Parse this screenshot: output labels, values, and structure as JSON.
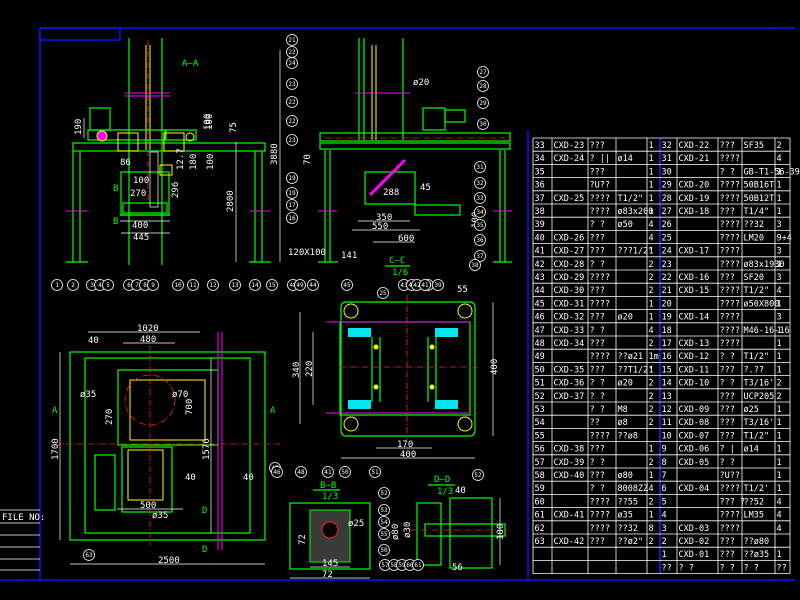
{
  "title_block": {
    "file_no_label": "FILE NO:"
  },
  "colors": {
    "background": "#000000",
    "frame": "#1010ff",
    "outline": "#00ff00",
    "hidden": "#ffff00",
    "center": "#ff2020",
    "section": "#00e5ee",
    "aux": "#ff00ff",
    "text": "#ffffff"
  },
  "views": {
    "aa": {
      "label": "A—A"
    },
    "cc": {
      "label": "C—C",
      "scale": "1/6"
    },
    "bb": {
      "label": "B—B",
      "scale": "1/3"
    },
    "dd": {
      "label": "D—D",
      "scale": "1/3"
    }
  },
  "dims": {
    "v1": [
      "190",
      "86",
      "100",
      "12.7",
      "180",
      "100",
      "75",
      "100",
      "296",
      "2800",
      "3880",
      "270",
      "400",
      "445",
      "100",
      "B",
      "B"
    ],
    "v2": [
      "ø20",
      "70",
      "45",
      "288",
      "350",
      "550",
      "600",
      "100",
      "120X100",
      "141"
    ],
    "v3": [
      "1020",
      "480",
      "40",
      "ø35",
      "270",
      "700",
      "ø70",
      "1700",
      "1576",
      "40",
      "40",
      "500",
      "ø35",
      "2500",
      "A",
      "A",
      "D",
      "D"
    ],
    "v4": [
      "55",
      "400",
      "340",
      "220",
      "170",
      "400"
    ],
    "bb": [
      "72",
      "145",
      "72",
      "ø25"
    ],
    "dd": [
      "40",
      "ø80",
      "ø30",
      "100",
      "56"
    ]
  },
  "balloons": {
    "v1_bottom": [
      "1",
      "2",
      "3",
      "4",
      "5",
      "6",
      "7",
      "8",
      "9",
      "10",
      "11",
      "12",
      "13",
      "14",
      "15"
    ],
    "v1_right": [
      "21",
      "22",
      "24",
      "23",
      "22",
      "22",
      "23",
      "19",
      "19",
      "17",
      "16"
    ],
    "v2_right": [
      "27",
      "28",
      "29",
      "30",
      "31",
      "32",
      "33",
      "34",
      "35",
      "36",
      "37",
      "38"
    ],
    "v2_bottom": [
      "48",
      "49",
      "44",
      "45",
      "43",
      "41",
      "40",
      "39"
    ],
    "v3": [
      "47",
      "63"
    ],
    "v4": [
      "25",
      "42",
      "41",
      "46",
      "48",
      "41",
      "50",
      "51",
      "52"
    ],
    "bb": [
      "52",
      "53",
      "54",
      "55",
      "50"
    ],
    "dd": [
      "57",
      "58",
      "59",
      "60",
      "61"
    ]
  },
  "parts_table": {
    "rows": [
      [
        [
          "33",
          "CXD-23",
          "???",
          "",
          "1"
        ],
        [
          "32",
          "CXD-22",
          "???",
          "SF35",
          "2"
        ]
      ],
      [
        [
          "34",
          "CXD-24",
          "? ||",
          "ø14",
          "1"
        ],
        [
          "31",
          "CXD-21",
          "????",
          "",
          "4"
        ]
      ],
      [
        [
          "35",
          "",
          "???",
          "",
          "1"
        ],
        [
          "30",
          "",
          "? ?",
          "GB-T1-56-39",
          "1"
        ]
      ],
      [
        [
          "36",
          "",
          "?U??",
          "",
          "1"
        ],
        [
          "29",
          "CXD-20",
          "????",
          "50B16T",
          "1"
        ]
      ],
      [
        [
          "37",
          "CXD-25",
          "????",
          "T1/2\"",
          "1"
        ],
        [
          "28",
          "CXD-19",
          "????",
          "50B12T",
          "1"
        ]
      ],
      [
        [
          "38",
          "",
          "????",
          "ø83x200",
          "1"
        ],
        [
          "27",
          "CXD-18",
          "???",
          "T1/4\"",
          "1"
        ]
      ],
      [
        [
          "39",
          "",
          "? ?",
          "ø50",
          "4"
        ],
        [
          "26",
          "",
          "????",
          "??32",
          "3"
        ]
      ],
      [
        [
          "40",
          "CXD-26",
          "???",
          "",
          "4"
        ],
        [
          "25",
          "",
          "????",
          "LM20",
          "9+4"
        ]
      ],
      [
        [
          "41",
          "CXD-27",
          "???",
          "???1/2\"",
          "1"
        ],
        [
          "24",
          "CXD-17",
          "????",
          "",
          "3"
        ]
      ],
      [
        [
          "42",
          "CXD-28",
          "? ?",
          "",
          "2"
        ],
        [
          "23",
          "",
          "????",
          "ø83x1930",
          "1"
        ]
      ],
      [
        [
          "43",
          "CXD-29",
          "????",
          "",
          "2"
        ],
        [
          "22",
          "CXD-16",
          "???",
          "SF20",
          "3"
        ]
      ],
      [
        [
          "44",
          "CXD-30",
          "???",
          "",
          "2"
        ],
        [
          "21",
          "CXD-15",
          "????",
          "T1/2\"",
          "4"
        ]
      ],
      [
        [
          "45",
          "CXD-31",
          "????",
          "",
          "1"
        ],
        [
          "20",
          "",
          "????",
          "ø50X800",
          "1"
        ]
      ],
      [
        [
          "46",
          "CXD-32",
          "???",
          "ø20",
          "1"
        ],
        [
          "19",
          "CXD-14",
          "????",
          "",
          "3"
        ]
      ],
      [
        [
          "47",
          "CXD-33",
          "? ?",
          "",
          "4"
        ],
        [
          "18",
          "",
          "????",
          "M46-16-16",
          "1"
        ]
      ],
      [
        [
          "48",
          "CXD-34",
          "???",
          "",
          "2"
        ],
        [
          "17",
          "CXD-13",
          "????",
          "",
          "1"
        ]
      ],
      [
        [
          "49",
          "",
          "????",
          "??ø21",
          "1m"
        ],
        [
          "16",
          "CXD-12",
          "? ?",
          "T1/2\"",
          "1"
        ]
      ],
      [
        [
          "50",
          "CXD-35",
          "???",
          "??T1/2\"",
          "1"
        ],
        [
          "15",
          "CXD-11",
          "???",
          "?.??",
          "1"
        ]
      ],
      [
        [
          "51",
          "CXD-36",
          "? ?",
          "ø20",
          "2"
        ],
        [
          "14",
          "CXD-10",
          "? ?",
          "T3/16'",
          "2"
        ]
      ],
      [
        [
          "52",
          "CXD-37",
          "? ?",
          "",
          "2"
        ],
        [
          "13",
          "",
          "???",
          "UCP205",
          "2"
        ]
      ],
      [
        [
          "53",
          "",
          "? ?",
          "M8",
          "2"
        ],
        [
          "12",
          "CXD-09",
          "???",
          "ø25",
          "1"
        ]
      ],
      [
        [
          "54",
          "",
          "??",
          "ø8",
          "2"
        ],
        [
          "11",
          "CXD-08",
          "???",
          "T3/16'",
          "1"
        ]
      ],
      [
        [
          "55",
          "",
          "????",
          "??ø8",
          ""
        ],
        [
          "10",
          "CXD-07",
          "???",
          "T1/2\"",
          "1"
        ]
      ],
      [
        [
          "56",
          "CXD-38",
          "???",
          "",
          "1"
        ],
        [
          "9",
          "CXD-06",
          "? |",
          "ø14",
          "1"
        ]
      ],
      [
        [
          "57",
          "CXD-39",
          "? ?",
          "",
          "2"
        ],
        [
          "8",
          "CXD-05",
          "? ?",
          "",
          "1"
        ]
      ],
      [
        [
          "58",
          "CXD-40",
          "???",
          "ø80",
          "1"
        ],
        [
          "7",
          "",
          "?U??",
          "",
          "1"
        ]
      ],
      [
        [
          "59",
          "",
          "? ?",
          "8008ZZ",
          "4"
        ],
        [
          "6",
          "CXD-04",
          "????",
          "T1/2'",
          "1"
        ]
      ],
      [
        [
          "60",
          "",
          "????",
          "??55",
          "2"
        ],
        [
          "5",
          "",
          "??? ?",
          "??52",
          "4"
        ]
      ],
      [
        [
          "61",
          "CXD-41",
          "????",
          "ø35",
          "1"
        ],
        [
          "4",
          "",
          "????",
          "LM35",
          "4"
        ]
      ],
      [
        [
          "62",
          "",
          "????",
          "??32",
          "8"
        ],
        [
          "3",
          "CXD-03",
          "????",
          "",
          "4"
        ]
      ],
      [
        [
          "63",
          "CXD-42",
          "???",
          "??ø2\"",
          "2"
        ],
        [
          "2",
          "CXD-02",
          "???",
          "??ø80",
          ""
        ]
      ],
      [
        [
          "",
          "",
          "",
          "",
          ""
        ],
        [
          "1",
          "CXD-01",
          "???",
          "??ø35",
          "1"
        ]
      ],
      [
        [
          "",
          "",
          "",
          "",
          ""
        ],
        [
          "??",
          "? ?",
          "? ?",
          "? ?",
          "??"
        ]
      ]
    ]
  }
}
